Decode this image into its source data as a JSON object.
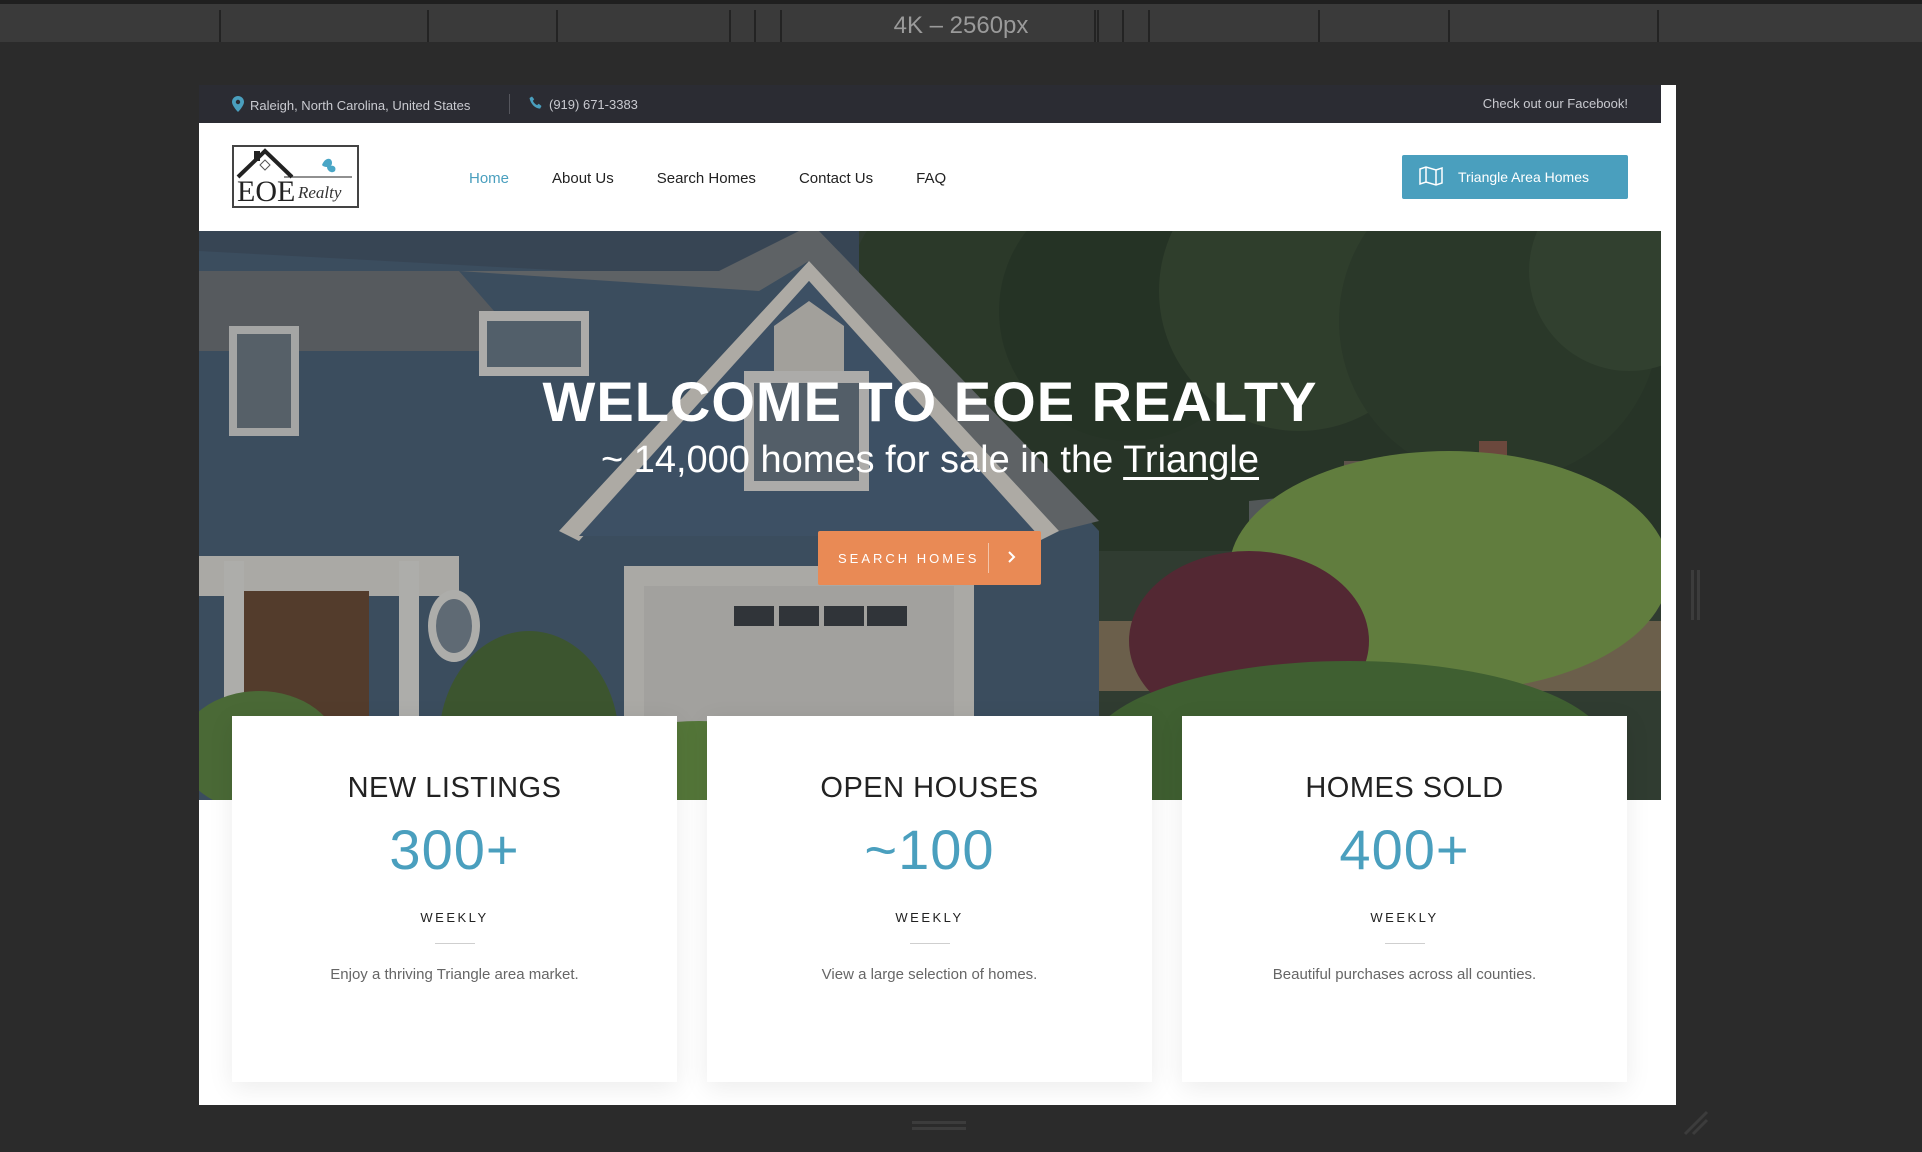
{
  "device": {
    "label": "4K – 2560px"
  },
  "topbar": {
    "location": "Raleigh, North Carolina, United States",
    "phone": "(919) 671-3383",
    "facebook": "Check out our Facebook!"
  },
  "logo": {
    "text_main": "EOE",
    "text_script": "Realty"
  },
  "nav": {
    "items": [
      {
        "label": "Home",
        "active": true
      },
      {
        "label": "About Us"
      },
      {
        "label": "Search Homes"
      },
      {
        "label": "Contact Us"
      },
      {
        "label": "FAQ"
      }
    ]
  },
  "cta": {
    "label": "Triangle Area Homes",
    "icon": "map-icon"
  },
  "hero": {
    "title": "WELCOME TO EOE REALTY",
    "subtitle_prefix": "~ 14,000 homes for sale in the ",
    "subtitle_link": "Triangle",
    "button_label": "SEARCH HOMES",
    "button_icon": "chevron-right-icon"
  },
  "stats": [
    {
      "title": "NEW LISTINGS",
      "value": "300+",
      "period": "WEEKLY",
      "desc": "Enjoy a thriving Triangle area market."
    },
    {
      "title": "OPEN HOUSES",
      "value": "~100",
      "period": "WEEKLY",
      "desc": "View a large selection of homes."
    },
    {
      "title": "HOMES SOLD",
      "value": "400+",
      "period": "WEEKLY",
      "desc": "Beautiful purchases across all counties."
    }
  ],
  "colors": {
    "accent": "#4a9fbe",
    "button_orange": "#e98a55",
    "topbar_bg": "#2b2c33",
    "chrome_bg": "#2b2b2b"
  }
}
